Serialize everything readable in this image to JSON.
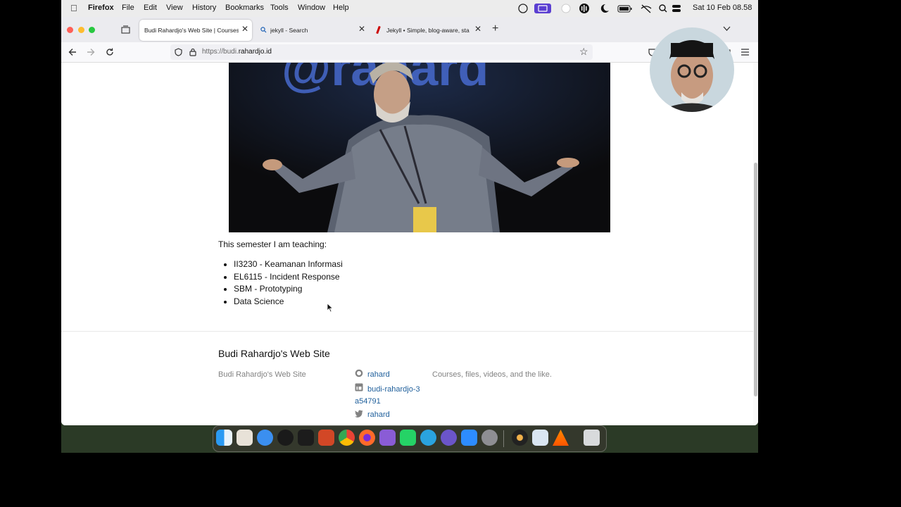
{
  "menubar": {
    "app": "Firefox",
    "items": [
      "File",
      "Edit",
      "View",
      "History",
      "Bookmarks",
      "Tools",
      "Window",
      "Help"
    ],
    "clock": "Sat 10 Feb  08.58"
  },
  "tabs": [
    {
      "label": "Budi Rahardjo's Web Site | Courses,",
      "active": true
    },
    {
      "label": "jekyll - Search",
      "active": false
    },
    {
      "label": "Jekyll • Simple, blog-aware, sta",
      "active": false
    }
  ],
  "url": {
    "prefix": "https://budi.",
    "domain": "rahardjo.id"
  },
  "hero_text": "@rahard",
  "page": {
    "intro": "This semester I am teaching:",
    "courses": [
      "II3230 - Keamanan Informasi",
      "EL6115 - Incident Response",
      "SBM - Prototyping",
      "Data Science"
    ]
  },
  "footer": {
    "title": "Budi Rahardjo's Web Site",
    "site_name": "Budi Rahardjo's Web Site",
    "github": "rahard",
    "linkedin": "budi-rahardjo-3a54791",
    "twitter": "rahard",
    "description": "Courses, files, videos, and the like."
  },
  "icons": {
    "github": "github-icon",
    "linkedin": "linkedin-icon",
    "twitter": "twitter-icon"
  },
  "colors": {
    "link": "#1f5f9b",
    "text": "#111111",
    "muted": "#828282"
  }
}
